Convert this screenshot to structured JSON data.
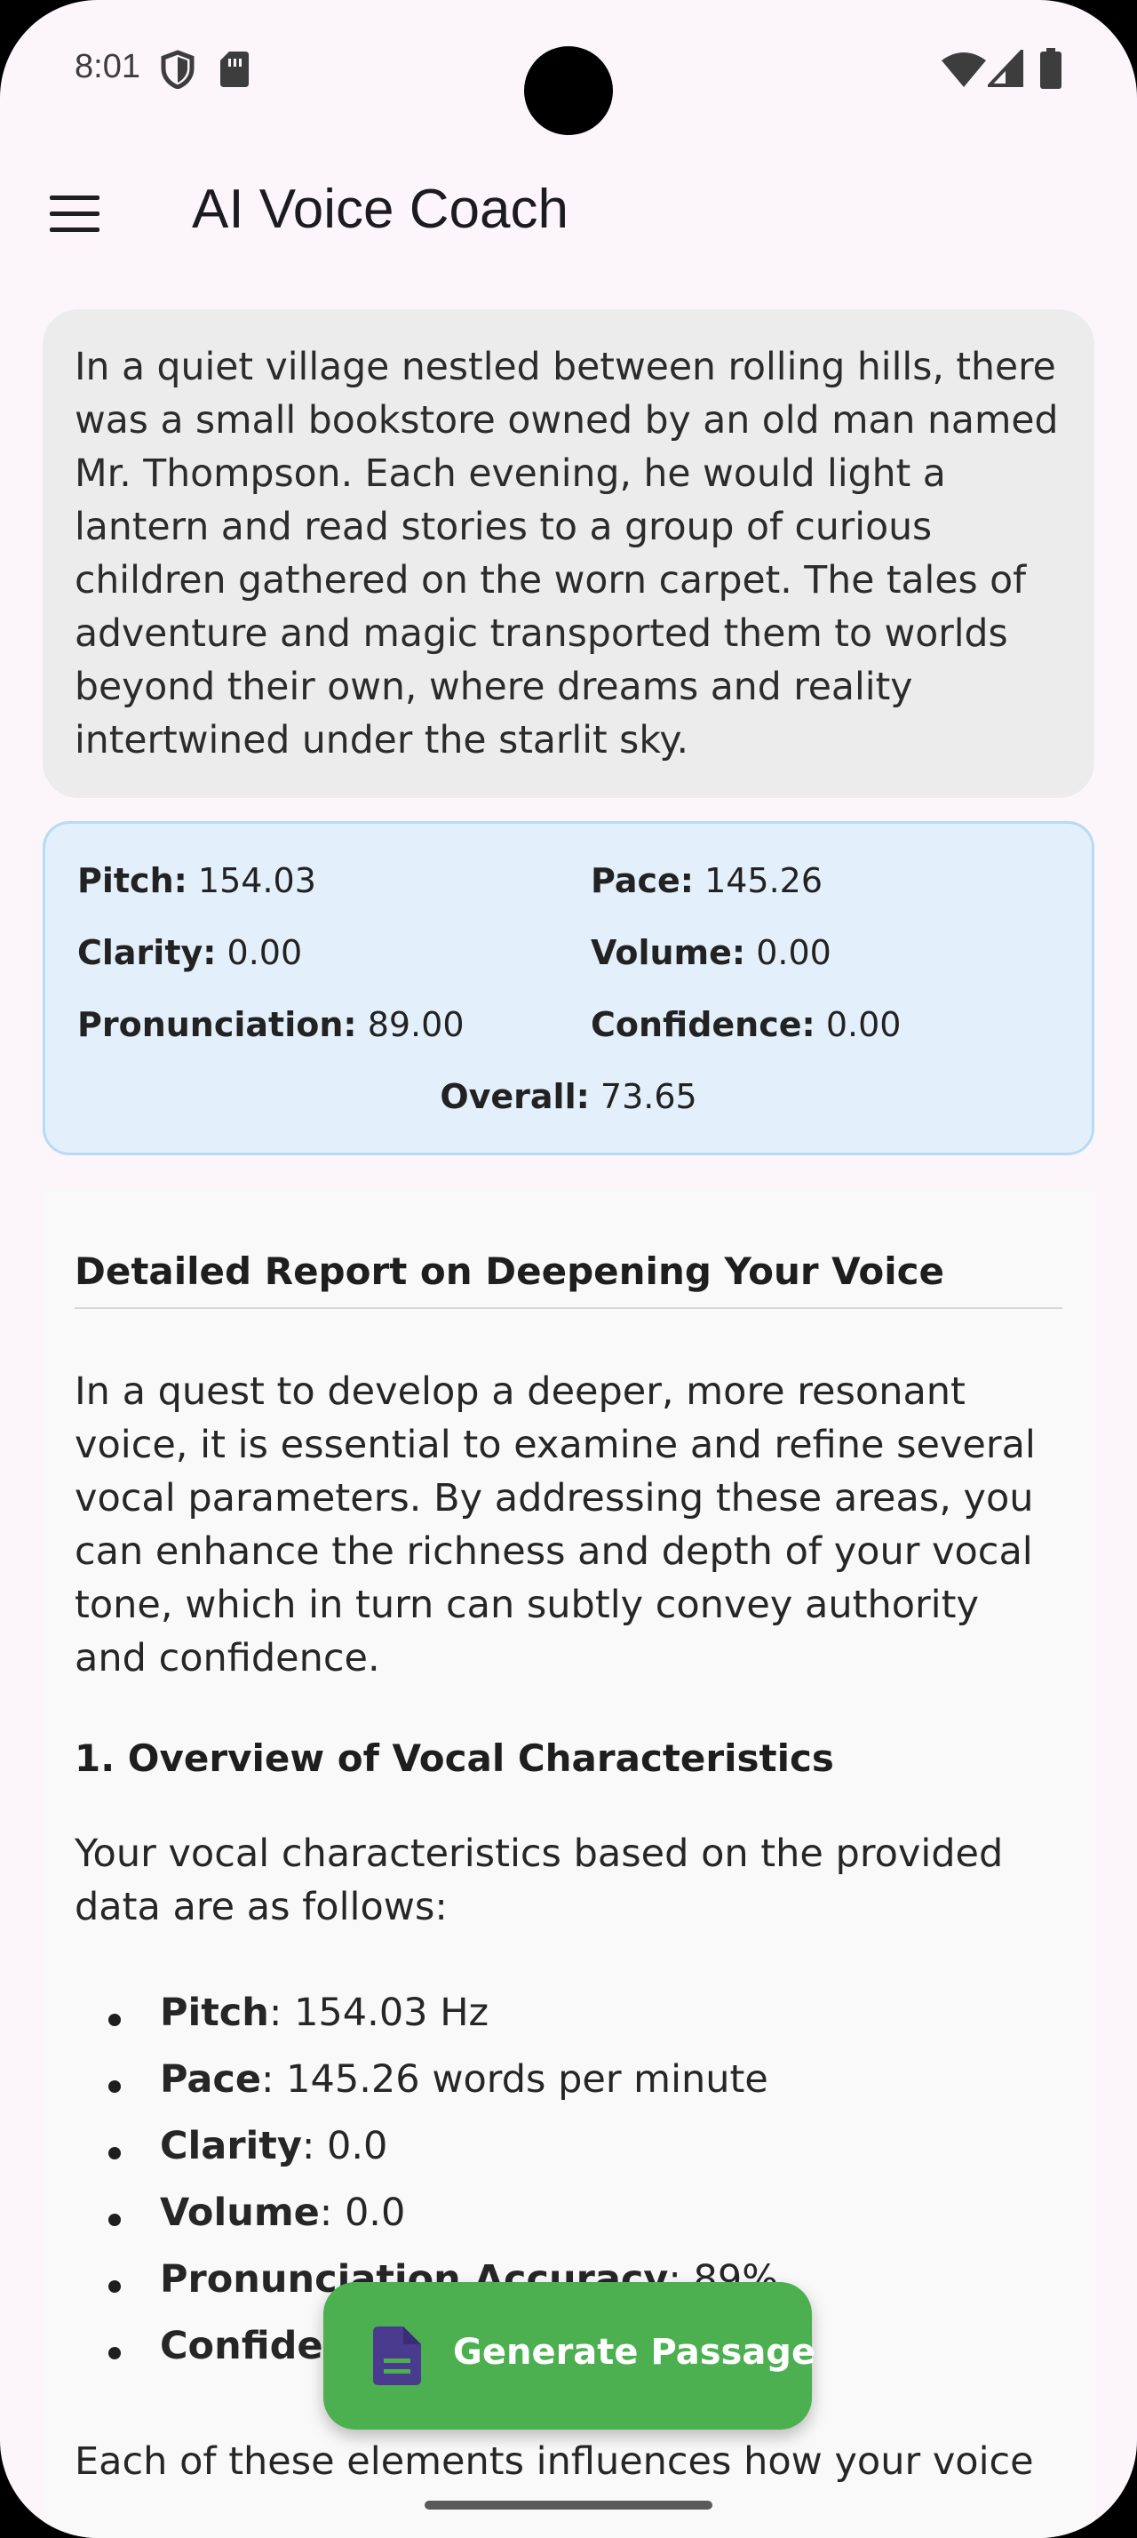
{
  "status_bar": {
    "time": "8:01"
  },
  "app_bar": {
    "title": "AI Voice Coach"
  },
  "passage": {
    "text": "In a quiet village nestled between rolling hills, there was a small bookstore owned by an old man named Mr. Thompson. Each evening, he would light a lantern and read stories to a group of curious children gathered on the worn carpet. The tales of adventure and magic transported them to worlds beyond their own, where dreams and reality intertwined under the starlit sky."
  },
  "metrics": {
    "pitch": {
      "label": "Pitch:",
      "value": "154.03"
    },
    "pace": {
      "label": "Pace:",
      "value": "145.26"
    },
    "clarity": {
      "label": "Clarity:",
      "value": "0.00"
    },
    "volume": {
      "label": "Volume:",
      "value": "0.00"
    },
    "pronunciation": {
      "label": "Pronunciation:",
      "value": "89.00"
    },
    "confidence": {
      "label": "Confidence:",
      "value": "0.00"
    },
    "overall": {
      "label": "Overall:",
      "value": "73.65"
    }
  },
  "report": {
    "title": "Detailed Report on Deepening Your Voice",
    "intro": "In a quest to develop a deeper, more resonant voice, it is essential to examine and refine several vocal parameters. By addressing these areas, you can enhance the richness and depth of your vocal tone, which in turn can subtly convey authority and confidence.",
    "section1_heading": "1. Overview of Vocal Characteristics",
    "section1_text": "Your vocal characteristics based on the provided data are as follows:",
    "bullets": [
      {
        "term": "Pitch",
        "rest": ": 154.03 Hz"
      },
      {
        "term": "Pace",
        "rest": ": 145.26 words per minute"
      },
      {
        "term": "Clarity",
        "rest": ": 0.0"
      },
      {
        "term": "Volume",
        "rest": ": 0.0"
      },
      {
        "term": "Pronunciation Accuracy",
        "rest": ": 89%"
      },
      {
        "term": "Confidence",
        "rest": ""
      }
    ],
    "closing": "Each of these elements influences how your voice"
  },
  "fab": {
    "label": "Generate Passage",
    "icon": "document-icon"
  },
  "colors": {
    "accent_green": "#4caf50",
    "metrics_bg": "#e3f0fb",
    "icon_purple": "#4a3b8f"
  }
}
